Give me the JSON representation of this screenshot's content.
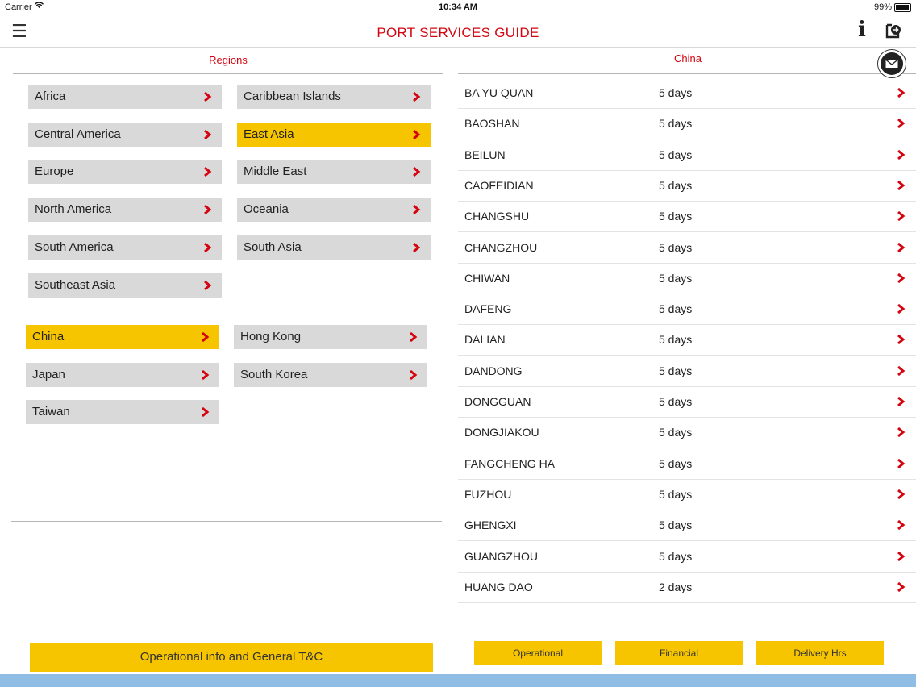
{
  "status_bar": {
    "carrier": "Carrier",
    "time": "10:34 AM",
    "battery": "99%"
  },
  "nav": {
    "title": "PORT SERVICES GUIDE",
    "menu_icon": "hamburger-icon",
    "info_label": "i",
    "share_icon": "share-icon"
  },
  "regions": {
    "title": "Regions",
    "items": [
      {
        "label": "Africa",
        "selected": false
      },
      {
        "label": "Caribbean Islands",
        "selected": false
      },
      {
        "label": "Central America",
        "selected": false
      },
      {
        "label": "East Asia",
        "selected": true
      },
      {
        "label": "Europe",
        "selected": false
      },
      {
        "label": "Middle East",
        "selected": false
      },
      {
        "label": "North America",
        "selected": false
      },
      {
        "label": "Oceania",
        "selected": false
      },
      {
        "label": "South America",
        "selected": false
      },
      {
        "label": "South Asia",
        "selected": false
      },
      {
        "label": "Southeast Asia",
        "selected": false
      }
    ]
  },
  "countries": {
    "items": [
      {
        "label": "China",
        "selected": true
      },
      {
        "label": "Hong Kong",
        "selected": false
      },
      {
        "label": "Japan",
        "selected": false
      },
      {
        "label": "South Korea",
        "selected": false
      },
      {
        "label": "Taiwan",
        "selected": false
      }
    ]
  },
  "operational_button": "Operational info and General T&C",
  "ports": {
    "title": "China",
    "rows": [
      {
        "name": "BA YU QUAN",
        "days": "5 days"
      },
      {
        "name": "BAOSHAN",
        "days": "5 days"
      },
      {
        "name": "BEILUN",
        "days": "5 days"
      },
      {
        "name": "CAOFEIDIAN",
        "days": "5 days"
      },
      {
        "name": "CHANGSHU",
        "days": "5 days"
      },
      {
        "name": "CHANGZHOU",
        "days": "5 days"
      },
      {
        "name": "CHIWAN",
        "days": "5 days"
      },
      {
        "name": "DAFENG",
        "days": "5 days"
      },
      {
        "name": "DALIAN",
        "days": "5 days"
      },
      {
        "name": "DANDONG",
        "days": "5 days"
      },
      {
        "name": "DONGGUAN",
        "days": "5 days"
      },
      {
        "name": "DONGJIAKOU",
        "days": "5 days"
      },
      {
        "name": "FANGCHENG HA",
        "days": "5 days"
      },
      {
        "name": "FUZHOU",
        "days": "5 days"
      },
      {
        "name": "GHENGXI",
        "days": "5 days"
      },
      {
        "name": "GUANGZHOU",
        "days": "5 days"
      },
      {
        "name": "HUANG DAO",
        "days": "2 days"
      }
    ]
  },
  "tabs": {
    "operational": "Operational",
    "financial": "Financial",
    "delivery": "Delivery Hrs"
  },
  "colors": {
    "accent_red": "#d40511",
    "selected_yellow": "#f7c500",
    "button_gray": "#d9d9d9"
  }
}
